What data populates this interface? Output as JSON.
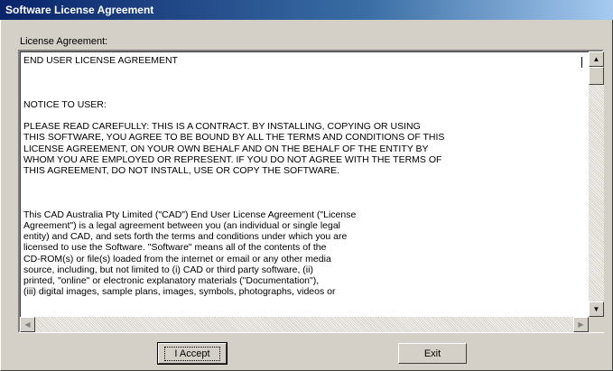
{
  "window": {
    "title": "Software License Agreement"
  },
  "group": {
    "label": "License Agreement:"
  },
  "license": {
    "text": "END USER LICENSE AGREEMENT\n\n\n\nNOTICE TO USER:\n\nPLEASE READ CAREFULLY: THIS IS A CONTRACT. BY INSTALLING, COPYING OR USING\nTHIS SOFTWARE, YOU AGREE TO BE BOUND BY ALL THE TERMS AND CONDITIONS OF THIS\nLICENSE AGREEMENT, ON YOUR OWN BEHALF AND ON THE BEHALF OF THE ENTITY BY\nWHOM YOU ARE EMPLOYED OR REPRESENT. IF YOU DO NOT AGREE WITH THE TERMS OF\nTHIS AGREEMENT, DO NOT INSTALL, USE OR COPY THE SOFTWARE.\n\n\n\nThis CAD Australia Pty Limited (\"CAD\") End User License Agreement (\"License\nAgreement\") is a legal agreement between you (an individual or single legal\nentity) and CAD, and sets forth the terms and conditions under which you are\nlicensed to use the Software. \"Software\" means all of the contents of the\nCD-ROM(s) or file(s) loaded from the internet or email or any other media\nsource, including, but not limited to (i) CAD or third party software, (ii)\nprinted, \"online\" or electronic explanatory materials (\"Documentation\"),\n(iii) digital images, sample plans, images, symbols, photographs, videos or"
  },
  "scrollbar": {
    "up_icon": "arrow-up",
    "down_icon": "arrow-down",
    "left_icon": "arrow-left",
    "right_icon": "arrow-right",
    "up_glyph": "▲",
    "down_glyph": "▼",
    "left_glyph": "◀",
    "right_glyph": "▶"
  },
  "buttons": {
    "accept_label": "I Accept",
    "exit_label": "Exit"
  }
}
